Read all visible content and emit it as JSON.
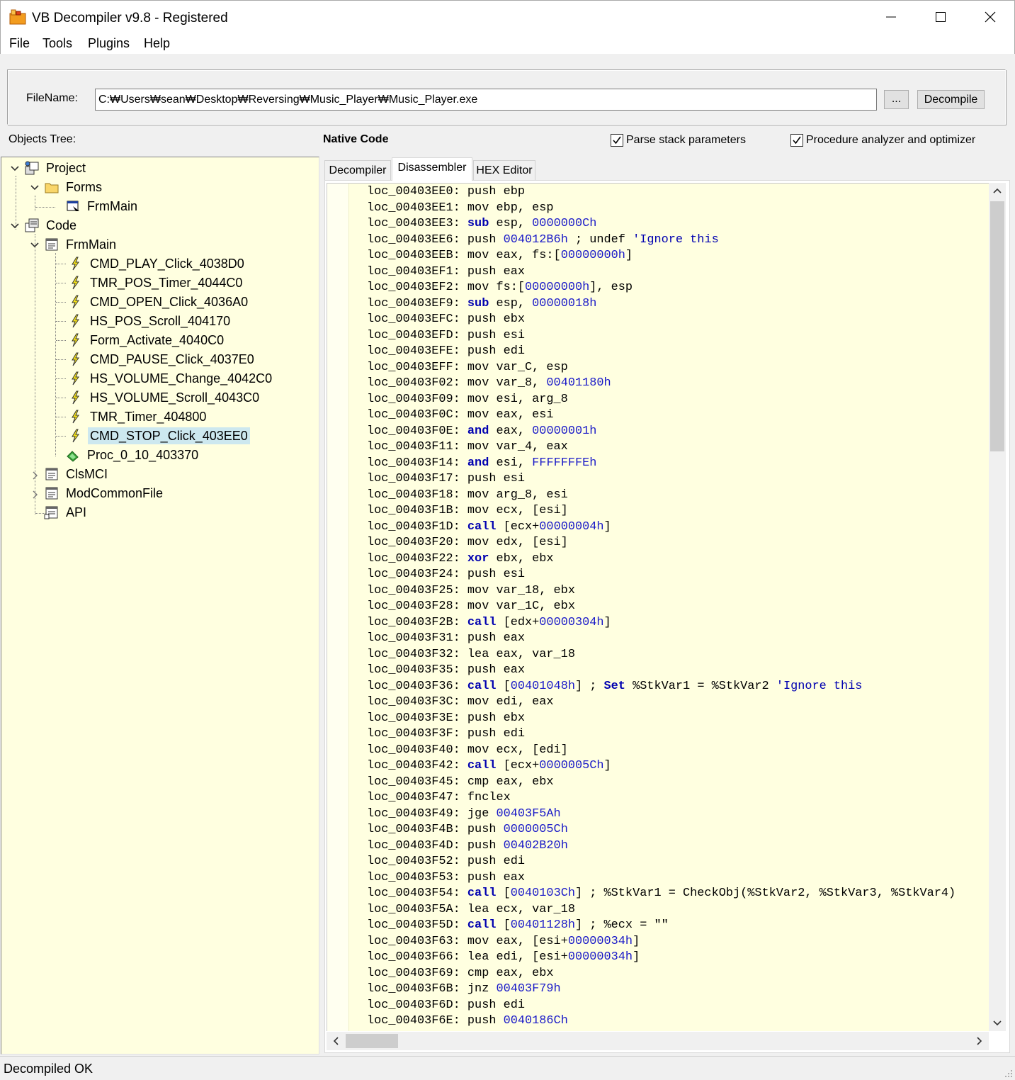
{
  "window": {
    "title": "VB Decompiler v9.8 - Registered",
    "minimize_glyph": "—",
    "maximize_glyph": "☐",
    "close_glyph": "✕"
  },
  "menu": {
    "file": "File",
    "tools": "Tools",
    "plugins": "Plugins",
    "help": "Help"
  },
  "filebar": {
    "label": "FileName:",
    "path": "C:₩Users₩sean₩Desktop₩Reversing₩Music_Player₩Music_Player.exe",
    "browse_label": "...",
    "decompile_label": "Decompile"
  },
  "toolbar": {
    "objects_tree_label": "Objects Tree:",
    "native_code_label": "Native Code",
    "parse_stack_label": "Parse stack parameters",
    "parse_stack_checked": true,
    "procedure_analyzer_label": "Procedure analyzer and optimizer",
    "procedure_analyzer_checked": true
  },
  "tree": {
    "project": "Project",
    "forms": "Forms",
    "forms_frmmain": "FrmMain",
    "code": "Code",
    "code_frmmain": "FrmMain",
    "procs": [
      "CMD_PLAY_Click_4038D0",
      "TMR_POS_Timer_4044C0",
      "CMD_OPEN_Click_4036A0",
      "HS_POS_Scroll_404170",
      "Form_Activate_4040C0",
      "CMD_PAUSE_Click_4037E0",
      "HS_VOLUME_Change_4042C0",
      "HS_VOLUME_Scroll_4043C0",
      "TMR_Timer_404800",
      "CMD_STOP_Click_403EE0"
    ],
    "selected_proc": "CMD_STOP_Click_403EE0",
    "proc_0": "Proc_0_10_403370",
    "clsmci": "ClsMCI",
    "modcommonfile": "ModCommonFile",
    "api": "API"
  },
  "tabs": {
    "decompiler": "Decompiler",
    "disassembler": "Disassembler",
    "hex_editor": "HEX Editor",
    "active": "Disassembler"
  },
  "disassembly": [
    [
      "loc_00403EE0:",
      "push ebp"
    ],
    [
      "loc_00403EE1:",
      "mov ebp, esp"
    ],
    [
      "loc_00403EE3:",
      "sub esp, 0000000Ch"
    ],
    [
      "loc_00403EE6:",
      "push 004012B6h ; undef 'Ignore this"
    ],
    [
      "loc_00403EEB:",
      "mov eax, fs:[00000000h]"
    ],
    [
      "loc_00403EF1:",
      "push eax"
    ],
    [
      "loc_00403EF2:",
      "mov fs:[00000000h], esp"
    ],
    [
      "loc_00403EF9:",
      "sub esp, 00000018h"
    ],
    [
      "loc_00403EFC:",
      "push ebx"
    ],
    [
      "loc_00403EFD:",
      "push esi"
    ],
    [
      "loc_00403EFE:",
      "push edi"
    ],
    [
      "loc_00403EFF:",
      "mov var_C, esp"
    ],
    [
      "loc_00403F02:",
      "mov var_8, 00401180h"
    ],
    [
      "loc_00403F09:",
      "mov esi, arg_8"
    ],
    [
      "loc_00403F0C:",
      "mov eax, esi"
    ],
    [
      "loc_00403F0E:",
      "and eax, 00000001h"
    ],
    [
      "loc_00403F11:",
      "mov var_4, eax"
    ],
    [
      "loc_00403F14:",
      "and esi, FFFFFFFEh"
    ],
    [
      "loc_00403F17:",
      "push esi"
    ],
    [
      "loc_00403F18:",
      "mov arg_8, esi"
    ],
    [
      "loc_00403F1B:",
      "mov ecx, [esi]"
    ],
    [
      "loc_00403F1D:",
      "call [ecx+00000004h]"
    ],
    [
      "loc_00403F20:",
      "mov edx, [esi]"
    ],
    [
      "loc_00403F22:",
      "xor ebx, ebx"
    ],
    [
      "loc_00403F24:",
      "push esi"
    ],
    [
      "loc_00403F25:",
      "mov var_18, ebx"
    ],
    [
      "loc_00403F28:",
      "mov var_1C, ebx"
    ],
    [
      "loc_00403F2B:",
      "call [edx+00000304h]"
    ],
    [
      "loc_00403F31:",
      "push eax"
    ],
    [
      "loc_00403F32:",
      "lea eax, var_18"
    ],
    [
      "loc_00403F35:",
      "push eax"
    ],
    [
      "loc_00403F36:",
      "call [00401048h] ; Set %StkVar1 = %StkVar2 'Ignore this"
    ],
    [
      "loc_00403F3C:",
      "mov edi, eax"
    ],
    [
      "loc_00403F3E:",
      "push ebx"
    ],
    [
      "loc_00403F3F:",
      "push edi"
    ],
    [
      "loc_00403F40:",
      "mov ecx, [edi]"
    ],
    [
      "loc_00403F42:",
      "call [ecx+0000005Ch]"
    ],
    [
      "loc_00403F45:",
      "cmp eax, ebx"
    ],
    [
      "loc_00403F47:",
      "fnclex"
    ],
    [
      "loc_00403F49:",
      "jge 00403F5Ah"
    ],
    [
      "loc_00403F4B:",
      "push 0000005Ch"
    ],
    [
      "loc_00403F4D:",
      "push 00402B20h"
    ],
    [
      "loc_00403F52:",
      "push edi"
    ],
    [
      "loc_00403F53:",
      "push eax"
    ],
    [
      "loc_00403F54:",
      "call [0040103Ch] ; %StkVar1 = CheckObj(%StkVar2, %StkVar3, %StkVar4)"
    ],
    [
      "loc_00403F5A:",
      "lea ecx, var_18"
    ],
    [
      "loc_00403F5D:",
      "call [00401128h] ; %ecx = \"\""
    ],
    [
      "loc_00403F63:",
      "mov eax, [esi+00000034h]"
    ],
    [
      "loc_00403F66:",
      "lea edi, [esi+00000034h]"
    ],
    [
      "loc_00403F69:",
      "cmp eax, ebx"
    ],
    [
      "loc_00403F6B:",
      "jnz 00403F79h"
    ],
    [
      "loc_00403F6D:",
      "push edi"
    ],
    [
      "loc_00403F6E:",
      "push 0040186Ch"
    ]
  ],
  "status": {
    "text": "Decompiled OK"
  },
  "colors": {
    "tree_background": "#ffffe0",
    "code_background": "#ffffe0",
    "selection": "#cde8ef",
    "keyword": "#0000b0",
    "number": "#1a1ac8"
  }
}
